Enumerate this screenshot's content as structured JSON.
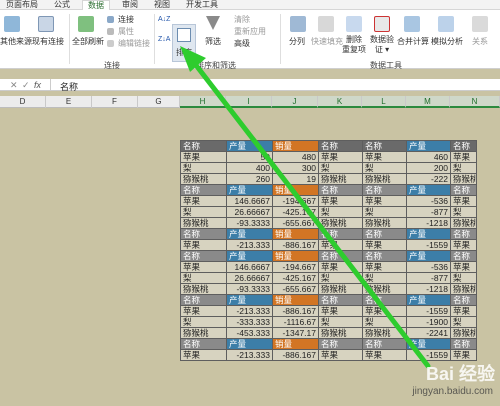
{
  "tabs": [
    "页面布局",
    "公式",
    "数据",
    "审阅",
    "视图",
    "开发工具"
  ],
  "ribbon": {
    "get_external": "其他来源",
    "existing_conn": "现有连接",
    "refresh_all": "全部刷新",
    "connections": "连接",
    "properties": "属性",
    "edit_links": "编辑链接",
    "group_connections": "连接",
    "sort_asc": "A↓Z",
    "sort_desc": "Z↓A",
    "sort": "排序",
    "filter": "筛选",
    "clear": "清除",
    "reapply": "重新应用",
    "advanced": "高级",
    "group_sort_filter": "排序和筛选",
    "text_to_col": "分列",
    "flash_fill": "快速填充",
    "remove_dup_1": "删除",
    "remove_dup_2": "重复项",
    "validation_1": "数据验",
    "validation_2": "证 ▾",
    "consolidate": "合并计算",
    "what_if": "模拟分析",
    "relations": "关系",
    "group_data_tools": "数据工具"
  },
  "formula_bar": {
    "cancel": "✕",
    "enter": "✓",
    "fx": "fx",
    "value": "名称"
  },
  "columns": [
    "D",
    "E",
    "F",
    "G",
    "H",
    "I",
    "J",
    "K",
    "L",
    "M",
    "N"
  ],
  "table": {
    "rows": [
      [
        [
          "名称",
          "h"
        ],
        [
          "产量",
          "b"
        ],
        [
          "销量",
          "o"
        ],
        [
          "名称",
          "h"
        ],
        [
          "名称",
          "h"
        ],
        [
          "产量",
          "b"
        ],
        [
          "名称",
          "h"
        ]
      ],
      [
        [
          "苹果",
          ""
        ],
        [
          "50",
          ""
        ],
        [
          "480",
          ""
        ],
        [
          "苹果",
          ""
        ],
        [
          "苹果",
          ""
        ],
        [
          "460",
          ""
        ],
        [
          "苹果",
          ""
        ]
      ],
      [
        [
          "梨",
          ""
        ],
        [
          "400",
          ""
        ],
        [
          "300",
          ""
        ],
        [
          "梨",
          ""
        ],
        [
          "梨",
          ""
        ],
        [
          "200",
          ""
        ],
        [
          "梨",
          ""
        ]
      ],
      [
        [
          "猕猴桃",
          ""
        ],
        [
          "260",
          ""
        ],
        [
          "19",
          ""
        ],
        [
          "猕猴桃",
          ""
        ],
        [
          "猕猴桃",
          ""
        ],
        [
          "-222",
          ""
        ],
        [
          "猕猴桃",
          ""
        ]
      ],
      [
        [
          "名称",
          "g"
        ],
        [
          "产量",
          "b"
        ],
        [
          "销量",
          "o"
        ],
        [
          "名称",
          "g"
        ],
        [
          "名称",
          "g"
        ],
        [
          "产量",
          "b"
        ],
        [
          "名称",
          "g"
        ]
      ],
      [
        [
          "苹果",
          ""
        ],
        [
          "146.6667",
          ""
        ],
        [
          "-194.667",
          ""
        ],
        [
          "苹果",
          ""
        ],
        [
          "苹果",
          ""
        ],
        [
          "-536",
          ""
        ],
        [
          "苹果",
          ""
        ]
      ],
      [
        [
          "梨",
          ""
        ],
        [
          "26.66667",
          ""
        ],
        [
          "-425.167",
          ""
        ],
        [
          "梨",
          ""
        ],
        [
          "梨",
          ""
        ],
        [
          "-877",
          ""
        ],
        [
          "梨",
          ""
        ]
      ],
      [
        [
          "猕猴桃",
          ""
        ],
        [
          "-93.3333",
          ""
        ],
        [
          "-655.667",
          ""
        ],
        [
          "猕猴桃",
          ""
        ],
        [
          "猕猴桃",
          ""
        ],
        [
          "-1218",
          ""
        ],
        [
          "猕猴桃",
          ""
        ]
      ],
      [
        [
          "名称",
          "g"
        ],
        [
          "产量",
          "b"
        ],
        [
          "销量",
          "o"
        ],
        [
          "名称",
          "g"
        ],
        [
          "名称",
          "g"
        ],
        [
          "产量",
          "b"
        ],
        [
          "名称",
          "g"
        ]
      ],
      [
        [
          "苹果",
          ""
        ],
        [
          "-213.333",
          ""
        ],
        [
          "-886.167",
          ""
        ],
        [
          "苹果",
          ""
        ],
        [
          "苹果",
          ""
        ],
        [
          "-1559",
          ""
        ],
        [
          "苹果",
          ""
        ]
      ],
      [
        [
          "名称",
          "g"
        ],
        [
          "产量",
          "b"
        ],
        [
          "销量",
          "o"
        ],
        [
          "名称",
          "g"
        ],
        [
          "名称",
          "g"
        ],
        [
          "产量",
          "b"
        ],
        [
          "名称",
          "g"
        ]
      ],
      [
        [
          "苹果",
          ""
        ],
        [
          "146.6667",
          ""
        ],
        [
          "-194.667",
          ""
        ],
        [
          "苹果",
          ""
        ],
        [
          "苹果",
          ""
        ],
        [
          "-536",
          ""
        ],
        [
          "苹果",
          ""
        ]
      ],
      [
        [
          "梨",
          ""
        ],
        [
          "26.66667",
          ""
        ],
        [
          "-425.167",
          ""
        ],
        [
          "梨",
          ""
        ],
        [
          "梨",
          ""
        ],
        [
          "-877",
          ""
        ],
        [
          "梨",
          ""
        ]
      ],
      [
        [
          "猕猴桃",
          ""
        ],
        [
          "-93.3333",
          ""
        ],
        [
          "-655.667",
          ""
        ],
        [
          "猕猴桃",
          ""
        ],
        [
          "猕猴桃",
          ""
        ],
        [
          "-1218",
          ""
        ],
        [
          "猕猴桃",
          ""
        ]
      ],
      [
        [
          "名称",
          "g"
        ],
        [
          "产量",
          "b"
        ],
        [
          "销量",
          "o"
        ],
        [
          "名称",
          "g"
        ],
        [
          "名称",
          "g"
        ],
        [
          "产量",
          "b"
        ],
        [
          "名称",
          "g"
        ]
      ],
      [
        [
          "苹果",
          ""
        ],
        [
          "-213.333",
          ""
        ],
        [
          "-886.167",
          ""
        ],
        [
          "苹果",
          ""
        ],
        [
          "苹果",
          ""
        ],
        [
          "-1559",
          ""
        ],
        [
          "苹果",
          ""
        ]
      ],
      [
        [
          "梨",
          ""
        ],
        [
          "-333.333",
          ""
        ],
        [
          "-1116.67",
          ""
        ],
        [
          "梨",
          ""
        ],
        [
          "梨",
          ""
        ],
        [
          "-1900",
          ""
        ],
        [
          "梨",
          ""
        ]
      ],
      [
        [
          "猕猴桃",
          ""
        ],
        [
          "-453.333",
          ""
        ],
        [
          "-1347.17",
          ""
        ],
        [
          "猕猴桃",
          ""
        ],
        [
          "猕猴桃",
          ""
        ],
        [
          "-2241",
          ""
        ],
        [
          "猕猴桃",
          ""
        ]
      ],
      [
        [
          "名称",
          "g"
        ],
        [
          "产量",
          "b"
        ],
        [
          "销量",
          "o"
        ],
        [
          "名称",
          "g"
        ],
        [
          "名称",
          "g"
        ],
        [
          "产量",
          "b"
        ],
        [
          "名称",
          "g"
        ]
      ],
      [
        [
          "苹果",
          ""
        ],
        [
          "-213.333",
          ""
        ],
        [
          "-886.167",
          ""
        ],
        [
          "苹果",
          ""
        ],
        [
          "苹果",
          ""
        ],
        [
          "-1559",
          ""
        ],
        [
          "苹果",
          ""
        ]
      ]
    ]
  },
  "watermark": {
    "brand": "Bai 经验",
    "url": "jingyan.baidu.com"
  },
  "colors": {
    "accent_green": "#2ecc2e",
    "header_blue": "#3c7ea8",
    "header_orange": "#d27524",
    "header_gray": "#8a8a8a"
  }
}
